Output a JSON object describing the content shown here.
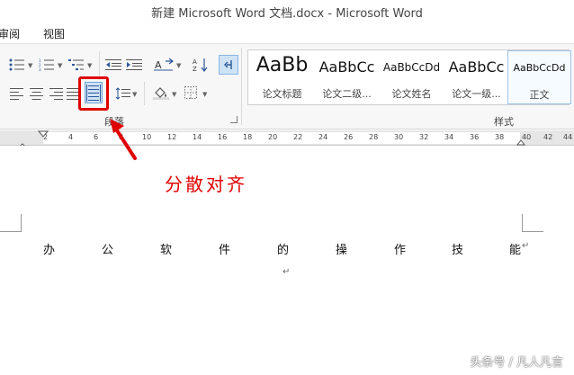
{
  "window": {
    "title": "新建 Microsoft Word 文档.docx - Microsoft Word"
  },
  "menu": {
    "items": [
      "审阅",
      "视图"
    ]
  },
  "ribbon": {
    "paragraph_group_label": "段落",
    "styles_group_label": "样式",
    "styles": [
      {
        "sample": "AaBb",
        "name": "论文标题",
        "selected": false
      },
      {
        "sample": "AaBbCc",
        "name": "论文二级...",
        "selected": false
      },
      {
        "sample": "AaBbCcDd",
        "name": "论文姓名",
        "selected": false
      },
      {
        "sample": "AaBbCc",
        "name": "论文一级...",
        "selected": false
      },
      {
        "sample": "AaBbCcDd",
        "name": "正文",
        "selected": true
      }
    ],
    "highlight_color": "#e00000"
  },
  "ruler": {
    "numbers": [
      "2",
      "4",
      "6",
      "8",
      "10",
      "12",
      "14",
      "16",
      "18",
      "20",
      "22",
      "24",
      "26",
      "28",
      "30",
      "32",
      "34",
      "36",
      "38",
      "40",
      "42",
      "44"
    ]
  },
  "document": {
    "annotation": "分散对齐",
    "line_chars": [
      "办",
      "公",
      "软",
      "件",
      "的",
      "操",
      "作",
      "技",
      "能"
    ],
    "paragraph_mark": "↵"
  },
  "watermark": "头条号 / 凡人凡言"
}
